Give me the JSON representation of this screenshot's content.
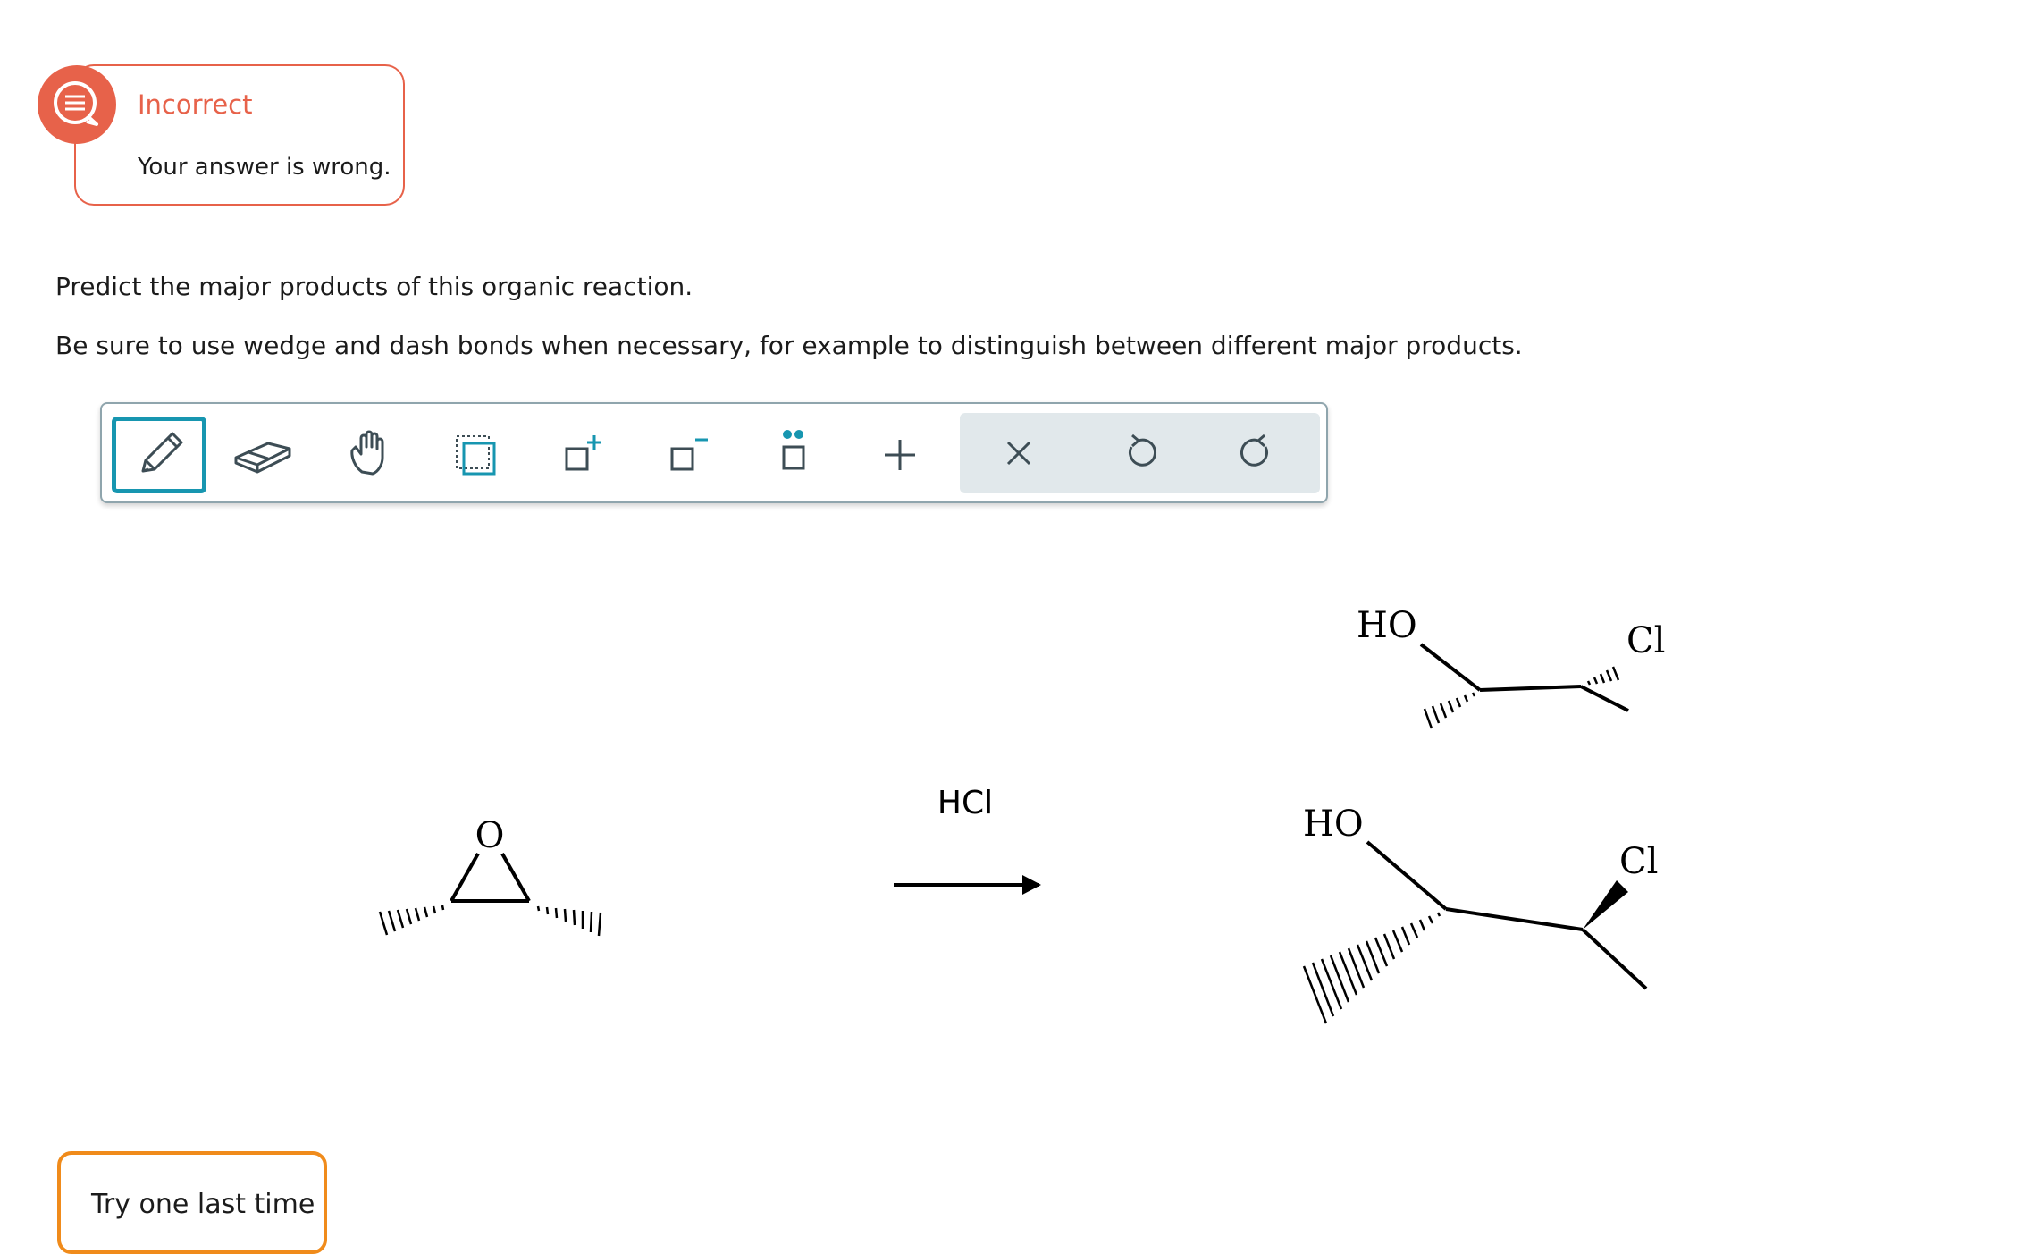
{
  "feedback": {
    "status": "Incorrect",
    "detail": "Your answer is wrong.",
    "icon": "speech-bubble-icon",
    "color": "#e7624a"
  },
  "question": {
    "line1": "Predict the major products of this organic reaction.",
    "line2": "Be sure to use wedge and dash bonds when necessary, for example to distinguish between different major products."
  },
  "toolbar": {
    "active_tool": "pencil",
    "tools": [
      {
        "name": "pencil-tool",
        "icon": "pencil-icon"
      },
      {
        "name": "eraser-tool",
        "icon": "eraser-icon"
      },
      {
        "name": "hand-tool",
        "icon": "hand-icon"
      },
      {
        "name": "select-tool",
        "icon": "marquee-select-icon"
      },
      {
        "name": "add-positive-charge-tool",
        "icon": "positive-charge-icon"
      },
      {
        "name": "add-negative-charge-tool",
        "icon": "negative-charge-icon"
      },
      {
        "name": "add-lone-pair-tool",
        "icon": "lone-pair-icon"
      },
      {
        "name": "add-arrow-tool",
        "icon": "plus-icon"
      }
    ],
    "actions": [
      {
        "name": "clear-button",
        "icon": "close-icon"
      },
      {
        "name": "undo-button",
        "icon": "undo-icon"
      },
      {
        "name": "redo-button",
        "icon": "redo-icon"
      }
    ],
    "accent": "#1796b0"
  },
  "reaction": {
    "reactant_oxygen": "O",
    "reagent": "HCl",
    "product1": {
      "hydroxyl": "HO",
      "halogen": "Cl"
    },
    "product2": {
      "hydroxyl": "HO",
      "halogen": "Cl"
    }
  },
  "retry": {
    "label": "Try one last time",
    "color": "#f08b1b"
  }
}
